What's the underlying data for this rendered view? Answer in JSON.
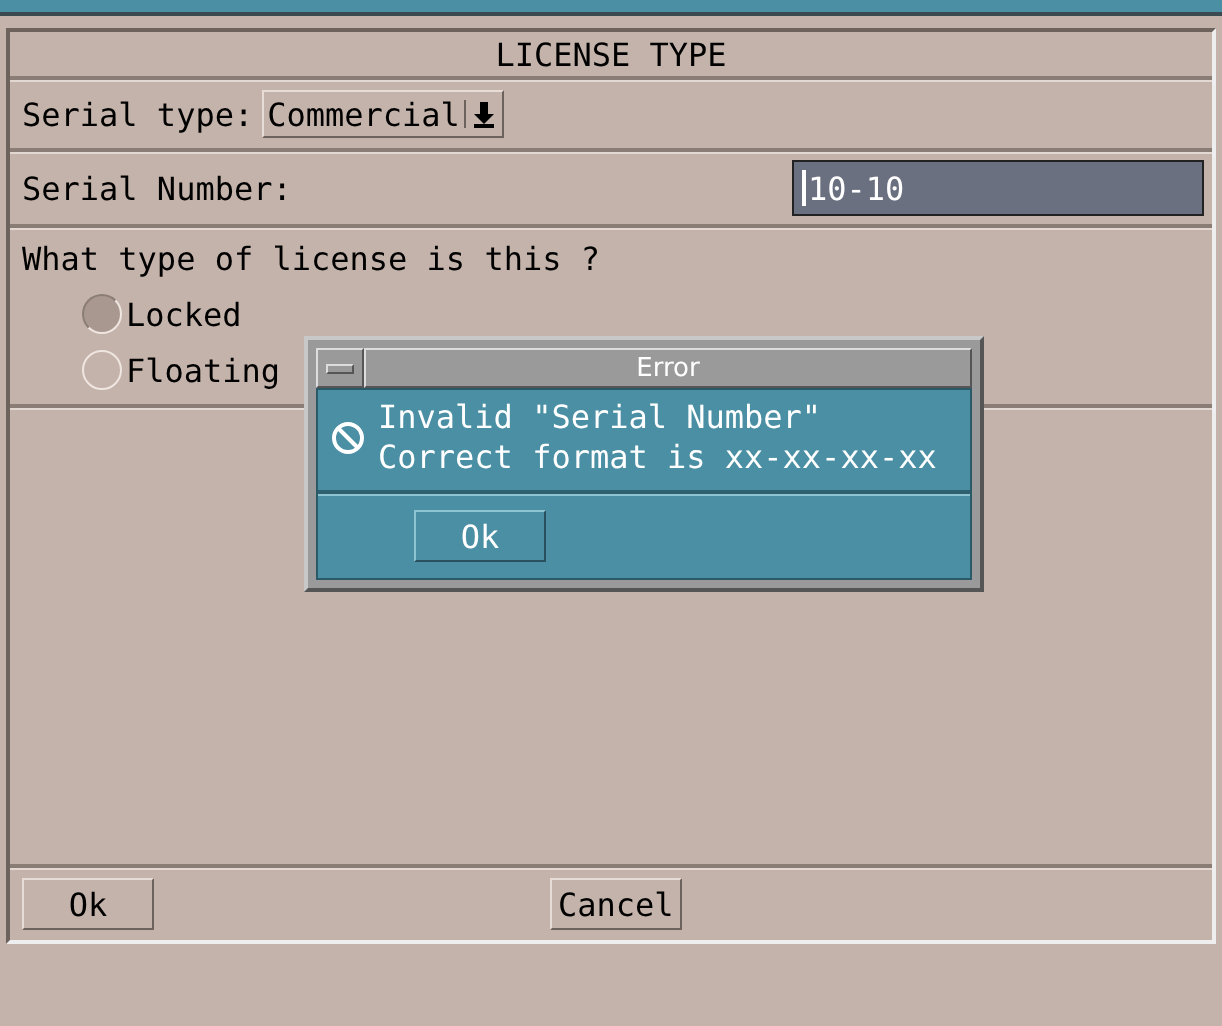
{
  "form": {
    "title": "LICENSE TYPE",
    "serial_type": {
      "label": "Serial type:",
      "value": "Commercial"
    },
    "serial_number": {
      "label": "Serial Number:",
      "value": "10-10"
    },
    "question": "What type of license is this ?",
    "license_options": [
      {
        "label": "Locked",
        "selected": true
      },
      {
        "label": "Floating",
        "selected": false
      }
    ],
    "buttons": [
      "Ok",
      "Cancel"
    ]
  },
  "error_dialog": {
    "title": "Error",
    "message": [
      "Invalid \"Serial Number\"",
      "Correct format is xx-xx-xx-xx"
    ],
    "button": "Ok"
  }
}
